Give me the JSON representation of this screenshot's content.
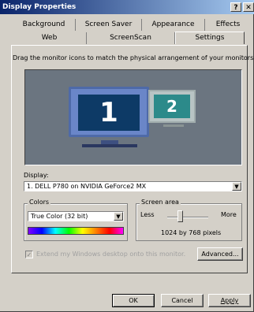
{
  "window": {
    "title": "Display Properties",
    "help_label": "?",
    "close_label": "✕"
  },
  "tabs": {
    "row1": [
      "Background",
      "Screen Saver",
      "Appearance",
      "Effects"
    ],
    "row2": [
      "Web",
      "ScreenScan",
      "Settings"
    ],
    "active": "Settings"
  },
  "settings": {
    "instruction": "Drag the monitor icons to match the physical arrangement of your monitors",
    "monitors": [
      {
        "number": "1",
        "primary": true
      },
      {
        "number": "2",
        "primary": false
      }
    ],
    "display_label": "Display:",
    "display_value": "1. DELL P780 on NVIDIA GeForce2 MX",
    "colors": {
      "title": "Colors",
      "value": "True Color (32 bit)"
    },
    "screen_area": {
      "title": "Screen area",
      "less_label": "Less",
      "more_label": "More",
      "resolution": "1024 by 768 pixels",
      "slider_level": 0.3
    },
    "extend_checkbox": {
      "label": "Extend my Windows desktop onto this monitor.",
      "checked": true,
      "enabled": false
    },
    "advanced_label": "Advanced..."
  },
  "buttons": {
    "ok": "OK",
    "cancel": "Cancel",
    "apply": "Apply"
  },
  "colors": {
    "titlebar": "#0a246a",
    "face": "#d4d0c8",
    "desktop_area": "#6b7580"
  },
  "icons": [
    "dropdown-arrow-icon",
    "checkmark-icon"
  ]
}
